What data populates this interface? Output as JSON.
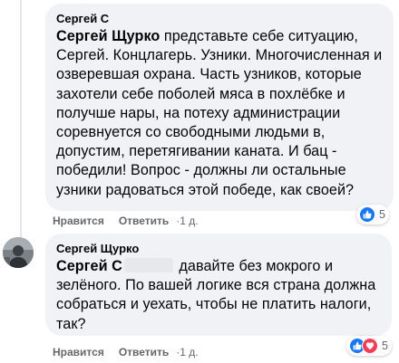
{
  "comments": [
    {
      "author": "Сергей С",
      "mention": "Сергей Щурко",
      "text": " представьте себе ситуацию, Сергей. Концлагерь. Узники. Многочисленная и озверевшая охрана. Часть узников, которые захотели себе поболей мяса в похлёбке и получше нары, на потеху администрации соревнуется со свободными людьми в, допустим, перетягивании каната. И бац - победили! Вопрос - должны ли остальные узники радоваться этой победе, как своей?",
      "like_label": "Нравится",
      "reply_label": "Ответить",
      "time": "1 д.",
      "reaction_count": "5",
      "reaction_icons": [
        "like-icon"
      ]
    },
    {
      "author": "Сергей Щурко",
      "mention": "Сергей С",
      "text": " давайте без мокрого и зелёного. По вашей логике вся страна должна собраться и уехать, чтобы не платить налоги, так?",
      "like_label": "Нравится",
      "reply_label": "Ответить",
      "time": "1 д.",
      "reaction_count": "5",
      "reaction_icons": [
        "like-icon",
        "love-icon"
      ]
    }
  ],
  "colors": {
    "bubble": "#f0f2f5",
    "like": "#1877f2",
    "love": "#f33e58",
    "meta_text": "#65676b"
  }
}
